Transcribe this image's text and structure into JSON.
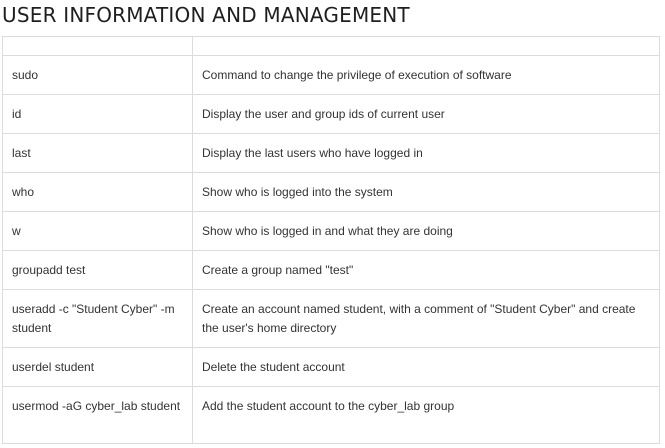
{
  "page": {
    "title": "USER INFORMATION AND MANAGEMENT"
  },
  "table": {
    "headers": [
      "",
      ""
    ],
    "rows": [
      {
        "command": "sudo",
        "description": "Command to change the privilege of execution of software"
      },
      {
        "command": "id",
        "description": "Display the user and group ids of current user"
      },
      {
        "command": "last",
        "description": "Display the last users who have logged in"
      },
      {
        "command": "who",
        "description": "Show who is logged into the system"
      },
      {
        "command": "w",
        "description": "Show who is logged in and what they are doing"
      },
      {
        "command": "groupadd test",
        "description": "Create a group named \"test\""
      },
      {
        "command": "useradd -c \"Student Cyber\" -m student",
        "description": "Create an account named student, with a comment of \"Student Cyber\" and create the user's home directory"
      },
      {
        "command": "userdel student",
        "description": "Delete the student account"
      },
      {
        "command": "usermod -aG cyber_lab student",
        "description": "Add the student account to the cyber_lab group"
      }
    ]
  }
}
